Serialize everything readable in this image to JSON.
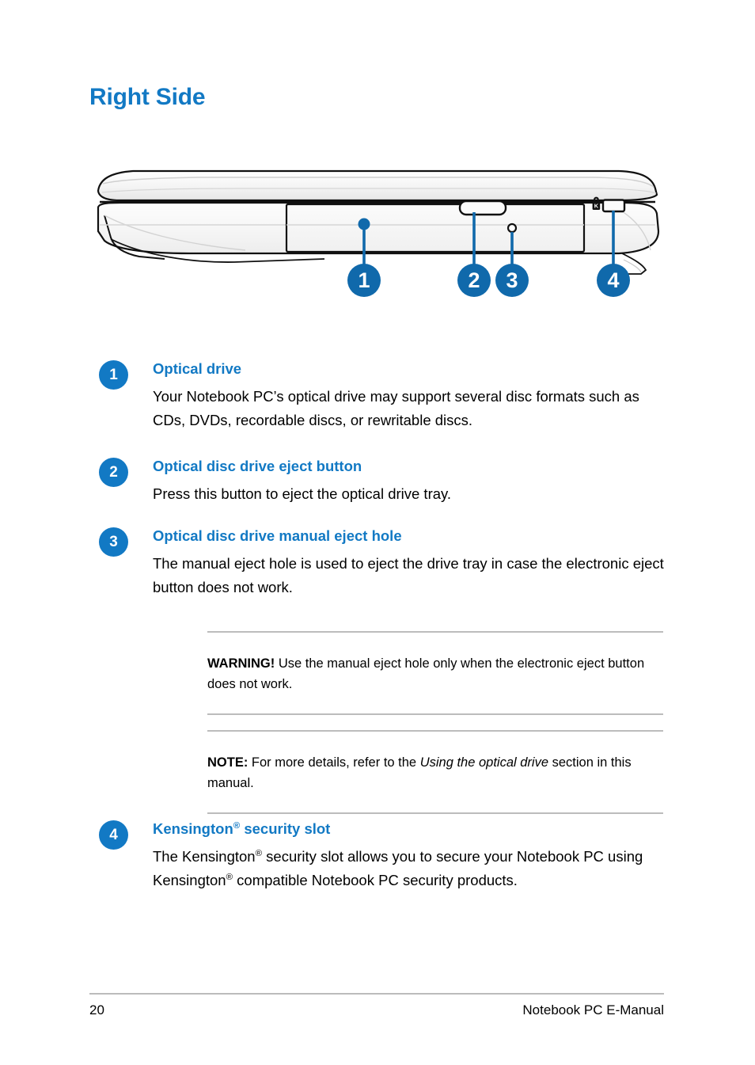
{
  "heading": "Right Side",
  "colors": {
    "accent": "#1279c4",
    "rule": "#bcbcbc",
    "text": "#000000"
  },
  "diagram": {
    "name": "notebook-right-side-view",
    "callouts": [
      {
        "number": "1",
        "target": "optical-drive"
      },
      {
        "number": "2",
        "target": "optical-disc-drive-eject-button"
      },
      {
        "number": "3",
        "target": "optical-disc-drive-manual-eject-hole"
      },
      {
        "number": "4",
        "target": "kensington-security-slot"
      }
    ],
    "parts": {
      "optical_drive_tray": "optical-drive-tray",
      "eject_button": "eject-button",
      "manual_eject_hole": "manual-eject-hole",
      "kensington_lock_icon": "kensington-lock-icon",
      "kensington_slot": "kensington-slot"
    }
  },
  "items": [
    {
      "number": "1",
      "title": "Optical drive",
      "description": "Your Notebook PC’s optical drive may support several disc formats such as CDs, DVDs, recordable discs, or rewritable discs."
    },
    {
      "number": "2",
      "title": "Optical disc drive eject button",
      "description": "Press this button to eject the optical drive tray."
    },
    {
      "number": "3",
      "title": "Optical disc drive manual eject hole",
      "description": "The manual eject hole is used to eject the drive tray in case the electronic eject button does not work."
    },
    {
      "number": "4",
      "title_parts": {
        "before": "Kensington",
        "reg": "®",
        "after": " security slot"
      },
      "title": "Kensington® security slot",
      "description_parts": {
        "p1": "The Kensington",
        "reg1": "®",
        "p2": " security slot allows you to secure your Notebook PC using Kensington",
        "reg2": "®",
        "p3": " compatible Notebook PC security products."
      },
      "description": "The Kensington® security slot allows you to secure your Notebook PC using Kensington® compatible Notebook PC security products."
    }
  ],
  "callouts": {
    "warning": {
      "lead": "WARNING!",
      "body": " Use the manual eject hole only when the electronic eject button does not work."
    },
    "note": {
      "lead": "NOTE:",
      "body_before": " For more details, refer to the ",
      "italic": "Using the optical drive",
      "body_after": " section in this manual."
    }
  },
  "footer": {
    "page_number": "20",
    "label": "Notebook PC E-Manual"
  }
}
